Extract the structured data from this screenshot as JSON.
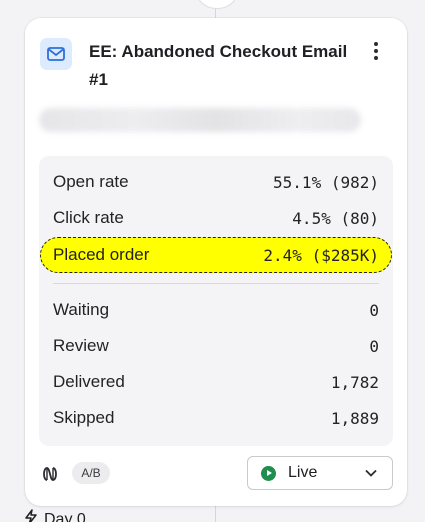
{
  "card": {
    "title": "EE: Abandoned Checkout Email #1",
    "icon": "envelope-icon",
    "menu_icon": "kebab-menu-icon"
  },
  "stats": {
    "rates": [
      {
        "label": "Open rate",
        "value": "55.1% (982)"
      },
      {
        "label": "Click rate",
        "value": "4.5% (80)"
      },
      {
        "label": "Placed order",
        "value": "2.4% ($285K)",
        "highlighted": true
      }
    ],
    "counts": [
      {
        "label": "Waiting",
        "value": "0"
      },
      {
        "label": "Review",
        "value": "0"
      },
      {
        "label": "Delivered",
        "value": "1,782"
      },
      {
        "label": "Skipped",
        "value": "1,889"
      }
    ],
    "highlight_color": "#ffff00"
  },
  "footer": {
    "smart_send_icon": "smart-sending-icon",
    "ab_badge": "A/B",
    "status": {
      "label": "Live",
      "color": "#1e8e4f",
      "icon": "play-circle-icon"
    }
  },
  "next_step": {
    "label": "Day 0",
    "icon": "lightning-icon"
  }
}
